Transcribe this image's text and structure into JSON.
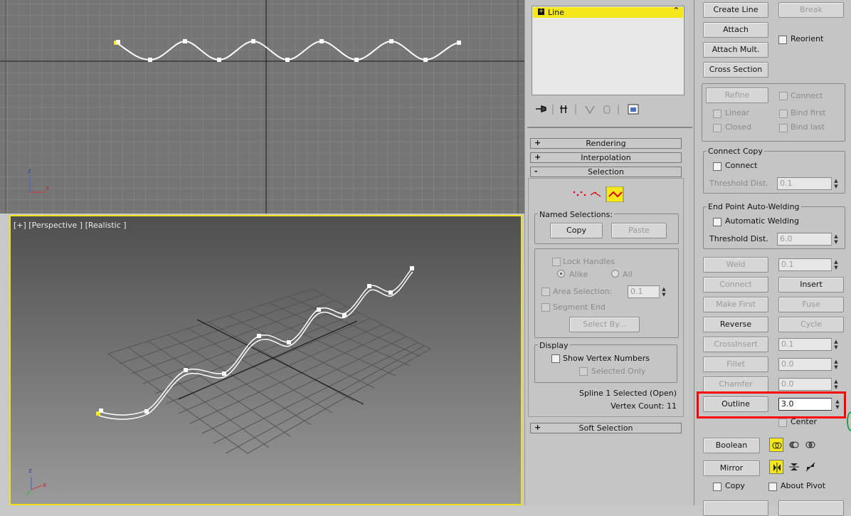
{
  "viewports": {
    "top": {
      "axis_z": "z",
      "axis_x": "x"
    },
    "perspective": {
      "label": "[+] [Perspective ] [Realistic ]",
      "axis_z": "z",
      "axis_x": "x"
    }
  },
  "modifier_stack": {
    "item_label": "Line",
    "rollouts": {
      "rendering": "Rendering",
      "interpolation": "Interpolation",
      "selection": "Selection",
      "soft_selection": "Soft Selection"
    },
    "named_selections": {
      "title": "Named Selections:",
      "copy": "Copy",
      "paste": "Paste"
    },
    "lock_handles": "Lock Handles",
    "alike": "Alike",
    "all": "All",
    "area_selection": "Area Selection:",
    "area_selection_value": "0.1",
    "segment_end": "Segment End",
    "select_by": "Select By...",
    "display": {
      "title": "Display",
      "show_vertex_numbers": "Show Vertex Numbers",
      "selected_only": "Selected Only"
    },
    "status_line1": "Spline 1 Selected (Open)",
    "status_line2": "Vertex Count: 11"
  },
  "geometry": {
    "create_line": "Create Line",
    "break": "Break",
    "attach": "Attach",
    "reorient": "Reorient",
    "attach_mult": "Attach Mult.",
    "cross_section": "Cross Section",
    "refine": "Refine",
    "connect_chk": "Connect",
    "linear": "Linear",
    "bind_first": "Bind first",
    "closed": "Closed",
    "bind_last": "Bind last",
    "connect_copy": {
      "title": "Connect Copy",
      "connect": "Connect",
      "threshold_label": "Threshold Dist.",
      "threshold_value": "0.1"
    },
    "end_point": {
      "title": "End Point Auto-Welding",
      "automatic_welding": "Automatic Welding",
      "threshold_label": "Threshold Dist.",
      "threshold_value": "6.0"
    },
    "weld": "Weld",
    "weld_value": "0.1",
    "connect_btn": "Connect",
    "insert": "Insert",
    "make_first": "Make First",
    "fuse": "Fuse",
    "reverse": "Reverse",
    "cycle": "Cycle",
    "crossinsert": "CrossInsert",
    "crossinsert_value": "0.1",
    "fillet": "Fillet",
    "fillet_value": "0.0",
    "chamfer": "Chamfer",
    "chamfer_value": "0.0",
    "outline": "Outline",
    "outline_value": "3.0",
    "center": "Center",
    "boolean": "Boolean",
    "mirror": "Mirror",
    "copy": "Copy",
    "about_pivot": "About Pivot"
  },
  "colors": {
    "highlight": "#ff0000",
    "selected_yellow": "#f5e81a",
    "vertex_white": "#ffffff"
  }
}
